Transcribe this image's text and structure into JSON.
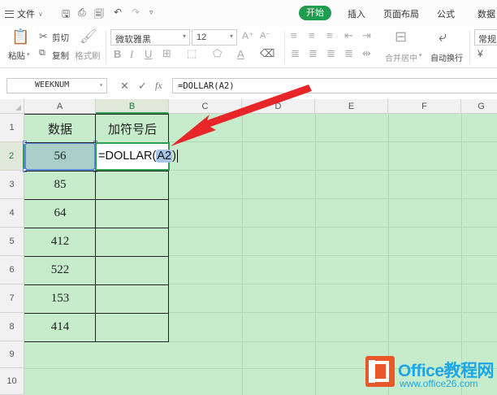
{
  "menubar": {
    "file_label": "文件",
    "tabs": [
      "开始",
      "插入",
      "页面布局",
      "公式",
      "数据"
    ],
    "active_tab": "开始"
  },
  "ribbon": {
    "paste_label": "粘贴",
    "cut_label": "剪切",
    "copy_label": "复制",
    "format_painter_label": "格式刷",
    "font_name": "微软雅黑",
    "font_size": "12",
    "merge_center_label": "合并居中",
    "wrap_text_label": "自动换行",
    "number_format": "常规"
  },
  "formula_bar": {
    "name_box": "WEEKNUM",
    "fx_label": "fx",
    "formula": "=DOLLAR(A2)"
  },
  "sheet": {
    "columns": [
      "A",
      "B",
      "C",
      "D",
      "E",
      "F",
      "G"
    ],
    "selected_column": "B",
    "rows": [
      "1",
      "2",
      "3",
      "4",
      "5",
      "6",
      "7",
      "8",
      "9",
      "10"
    ],
    "selected_row": "2",
    "headers": {
      "A1": "数据",
      "B1": "加符号后"
    },
    "values": [
      "56",
      "85",
      "64",
      "412",
      "522",
      "153",
      "414"
    ],
    "editing_cell": "B2",
    "edit_prefix": "=DOLLAR(",
    "edit_ref": "A2",
    "edit_suffix": ")"
  },
  "colors": {
    "accent": "#1f9c4d",
    "sheet_background": "#c6eccc",
    "arrow": "#e8262a",
    "logo_orange": "#e9572b",
    "logo_blue": "#1ea5e6"
  },
  "logo": {
    "title": "Office教程网",
    "url": "www.office26.com"
  }
}
